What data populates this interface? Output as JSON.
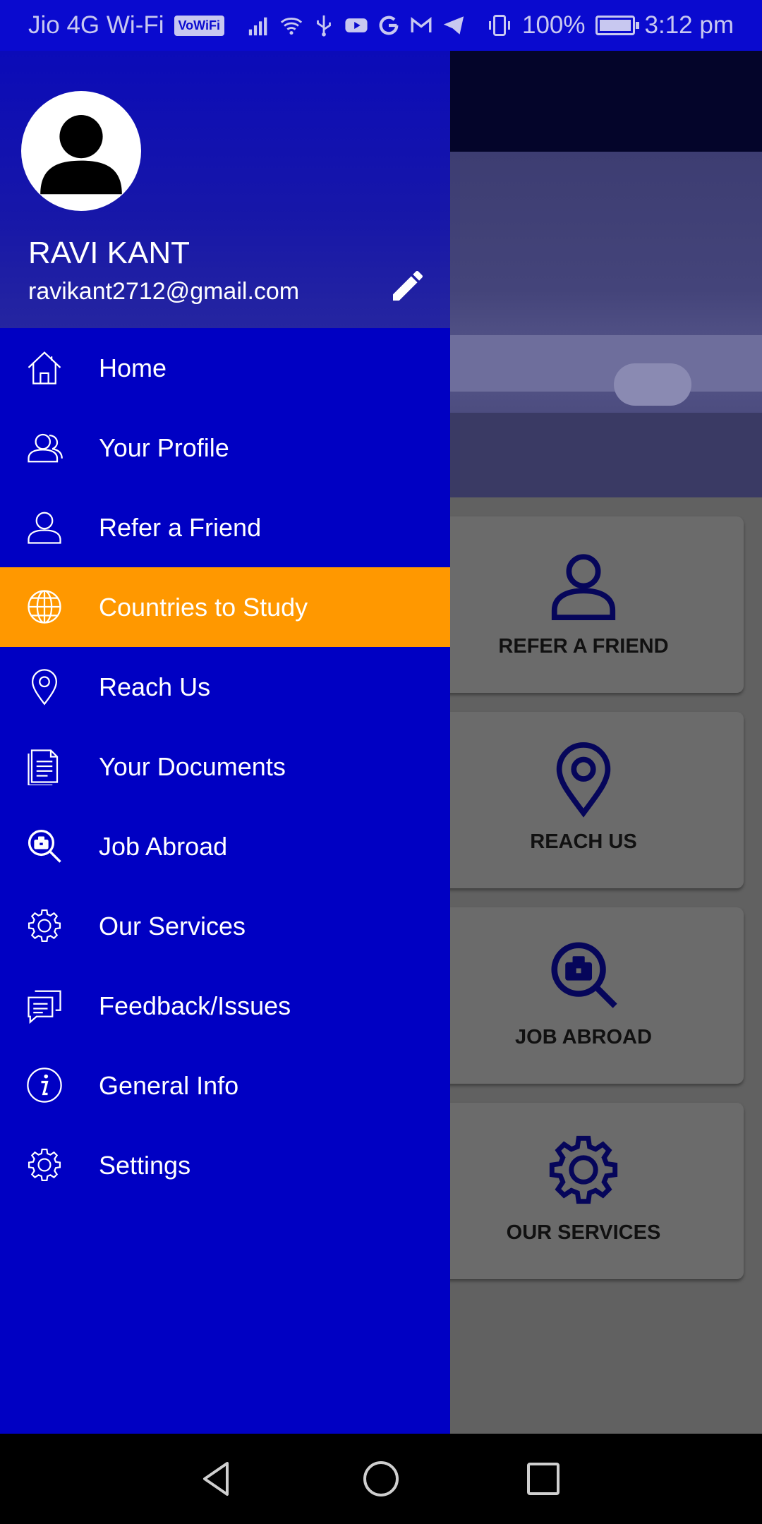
{
  "status_bar": {
    "carrier": "Jio 4G Wi-Fi",
    "vowifi": "VoWiFi",
    "battery": "100%",
    "time": "3:12 pm",
    "icons": [
      "signal-icon",
      "wifi-icon",
      "usb-icon",
      "youtube-icon",
      "google-icon",
      "gmail-icon",
      "telegram-icon",
      "vibrate-icon",
      "battery-charging-icon"
    ]
  },
  "drawer": {
    "user_name": "RAVI KANT",
    "user_email": "ravikant2712@gmail.com",
    "items": [
      {
        "label": "Home",
        "icon": "home-icon"
      },
      {
        "label": "Your Profile",
        "icon": "profile-icon"
      },
      {
        "label": "Refer a Friend",
        "icon": "user-icon"
      },
      {
        "label": "Countries to Study",
        "icon": "globe-icon",
        "active": true
      },
      {
        "label": "Reach Us",
        "icon": "location-pin-icon"
      },
      {
        "label": "Your Documents",
        "icon": "document-icon"
      },
      {
        "label": "Job Abroad",
        "icon": "job-search-icon"
      },
      {
        "label": "Our Services",
        "icon": "gear-icon"
      },
      {
        "label": "Feedback/Issues",
        "icon": "chat-icon"
      },
      {
        "label": "General Info",
        "icon": "info-icon"
      },
      {
        "label": "Settings",
        "icon": "settings-icon"
      }
    ]
  },
  "background_cards": [
    {
      "label": "REFER A FRIEND",
      "icon": "user-icon"
    },
    {
      "label": "REACH US",
      "icon": "location-pin-icon"
    },
    {
      "label": "JOB ABROAD",
      "icon": "job-search-icon"
    },
    {
      "label": "OUR SERVICES",
      "icon": "gear-icon"
    }
  ],
  "colors": {
    "drawer_bg": "#0000c3",
    "active_item": "#ff9800",
    "status_bar": "#0a0acf"
  }
}
